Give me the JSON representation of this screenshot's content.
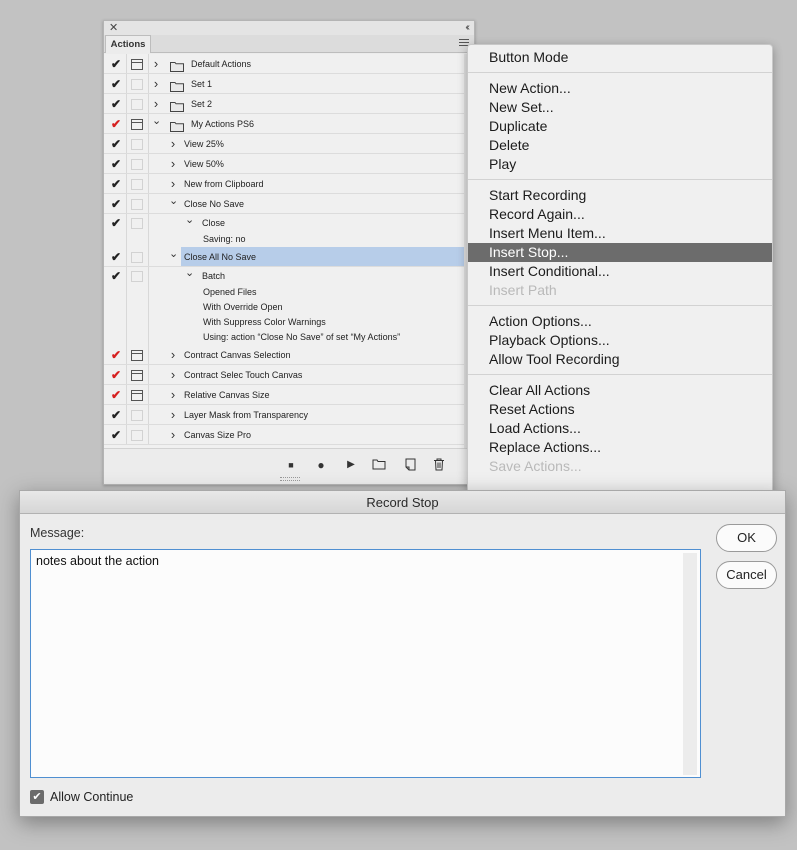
{
  "panel": {
    "close_glyph": "✕",
    "collapse_glyph": "‹‹",
    "tab_label": "Actions",
    "rows": [
      {
        "type": "set",
        "check": "✔",
        "check_color": "black",
        "dialog": true,
        "expanded": false,
        "label": "Default Actions"
      },
      {
        "type": "set",
        "check": "✔",
        "check_color": "black",
        "dialog": false,
        "expanded": false,
        "label": "Set 1"
      },
      {
        "type": "set",
        "check": "✔",
        "check_color": "black",
        "dialog": false,
        "expanded": false,
        "label": "Set 2"
      },
      {
        "type": "set",
        "check": "✔",
        "check_color": "red",
        "dialog": true,
        "expanded": true,
        "label": "My Actions PS6"
      },
      {
        "type": "action",
        "check": "✔",
        "check_color": "black",
        "dialog": false,
        "expanded": false,
        "label": "View 25%"
      },
      {
        "type": "action",
        "check": "✔",
        "check_color": "black",
        "dialog": false,
        "expanded": false,
        "label": "View 50%"
      },
      {
        "type": "action",
        "check": "✔",
        "check_color": "black",
        "dialog": false,
        "expanded": false,
        "label": "New from Clipboard"
      },
      {
        "type": "action",
        "check": "✔",
        "check_color": "black",
        "dialog": false,
        "expanded": true,
        "label": "Close No Save"
      },
      {
        "type": "command",
        "check": "✔",
        "check_color": "black",
        "dialog": false,
        "expanded": true,
        "label": "Close"
      },
      {
        "type": "detail",
        "label": "Saving: no"
      },
      {
        "type": "action",
        "check": "✔",
        "check_color": "black",
        "dialog": false,
        "expanded": true,
        "label": "Close All No Save",
        "selected": true
      },
      {
        "type": "command",
        "check": "✔",
        "check_color": "black",
        "dialog": false,
        "expanded": true,
        "label": "Batch"
      },
      {
        "type": "detail",
        "label": "Opened Files"
      },
      {
        "type": "detail",
        "label": "With Override Open"
      },
      {
        "type": "detail",
        "label": "With Suppress Color Warnings"
      },
      {
        "type": "detail",
        "label": "Using: action “Close No Save” of set “My Actions”"
      },
      {
        "type": "action",
        "check": "✔",
        "check_color": "red",
        "dialog": true,
        "expanded": false,
        "label": "Contract Canvas Selection"
      },
      {
        "type": "action",
        "check": "✔",
        "check_color": "red",
        "dialog": true,
        "expanded": false,
        "label": "Contract Selec Touch Canvas"
      },
      {
        "type": "action",
        "check": "✔",
        "check_color": "red",
        "dialog": true,
        "expanded": false,
        "label": "Relative Canvas Size"
      },
      {
        "type": "action",
        "check": "✔",
        "check_color": "black",
        "dialog": false,
        "expanded": false,
        "label": "Layer Mask from Transparency"
      },
      {
        "type": "action",
        "check": "✔",
        "check_color": "black",
        "dialog": false,
        "expanded": false,
        "label": "Canvas Size Pro"
      }
    ],
    "bottom_icons": [
      {
        "name": "stop-icon",
        "glyph": "■"
      },
      {
        "name": "record-icon",
        "glyph": "●"
      },
      {
        "name": "play-icon",
        "glyph": "▶"
      },
      {
        "name": "new-set-icon",
        "glyph": "folder"
      },
      {
        "name": "new-action-icon",
        "glyph": "page"
      },
      {
        "name": "delete-icon",
        "glyph": "trash"
      }
    ]
  },
  "menu": {
    "groups": [
      [
        {
          "label": "Button Mode"
        }
      ],
      [
        {
          "label": "New Action..."
        },
        {
          "label": "New Set..."
        },
        {
          "label": "Duplicate"
        },
        {
          "label": "Delete"
        },
        {
          "label": "Play"
        }
      ],
      [
        {
          "label": "Start Recording"
        },
        {
          "label": "Record Again..."
        },
        {
          "label": "Insert Menu Item..."
        },
        {
          "label": "Insert Stop...",
          "highlight": true
        },
        {
          "label": "Insert Conditional..."
        },
        {
          "label": "Insert Path",
          "disabled": true
        }
      ],
      [
        {
          "label": "Action Options..."
        },
        {
          "label": "Playback Options..."
        },
        {
          "label": "Allow Tool Recording"
        }
      ],
      [
        {
          "label": "Clear All Actions"
        },
        {
          "label": "Reset Actions"
        },
        {
          "label": "Load Actions..."
        },
        {
          "label": "Replace Actions..."
        },
        {
          "label": "Save Actions...",
          "disabled": true
        }
      ]
    ]
  },
  "dialog": {
    "title": "Record Stop",
    "message_label": "Message:",
    "message_text": "notes about the action",
    "ok_label": "OK",
    "cancel_label": "Cancel",
    "allow_continue_label": "Allow Continue",
    "allow_continue_checked": true
  }
}
